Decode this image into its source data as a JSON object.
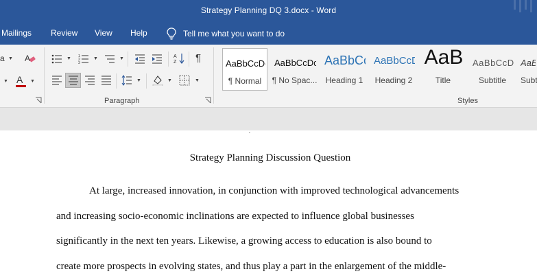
{
  "window": {
    "title": "Strategy Planning DQ 3.docx  -  Word"
  },
  "tabs": [
    "Mailings",
    "Review",
    "View",
    "Help"
  ],
  "tell_me": "Tell me what you want to do",
  "ribbon": {
    "font_partial": "a",
    "groups": {
      "paragraph": "Paragraph",
      "styles": "Styles"
    },
    "styles": [
      {
        "preview": "AaBbCcDc",
        "name": "¶ Normal"
      },
      {
        "preview": "AaBbCcDc",
        "name": "¶ No Spac..."
      },
      {
        "preview": "AaBbCc",
        "name": "Heading 1"
      },
      {
        "preview": "AaBbCcD",
        "name": "Heading 2"
      },
      {
        "preview": "AaB",
        "name": "Title"
      },
      {
        "preview": "AaBbCcD",
        "name": "Subtitle"
      },
      {
        "preview": "AaBl",
        "name": "Subtl"
      }
    ]
  },
  "document": {
    "heading": "Strategy Planning Discussion Question",
    "lines": [
      "At large, increased innovation, in conjunction with improved technological advancements",
      "and increasing socio-economic inclinations are expected to influence global businesses",
      "significantly in the next ten years. Likewise, a growing access to education is also bound to",
      "create more prospects in evolving states, and thus play a part in the enlargement of the middle-"
    ]
  },
  "colors": {
    "accent": "#2b579a",
    "font_color_bar": "#c00000",
    "heading_style": "#2e74b5"
  }
}
